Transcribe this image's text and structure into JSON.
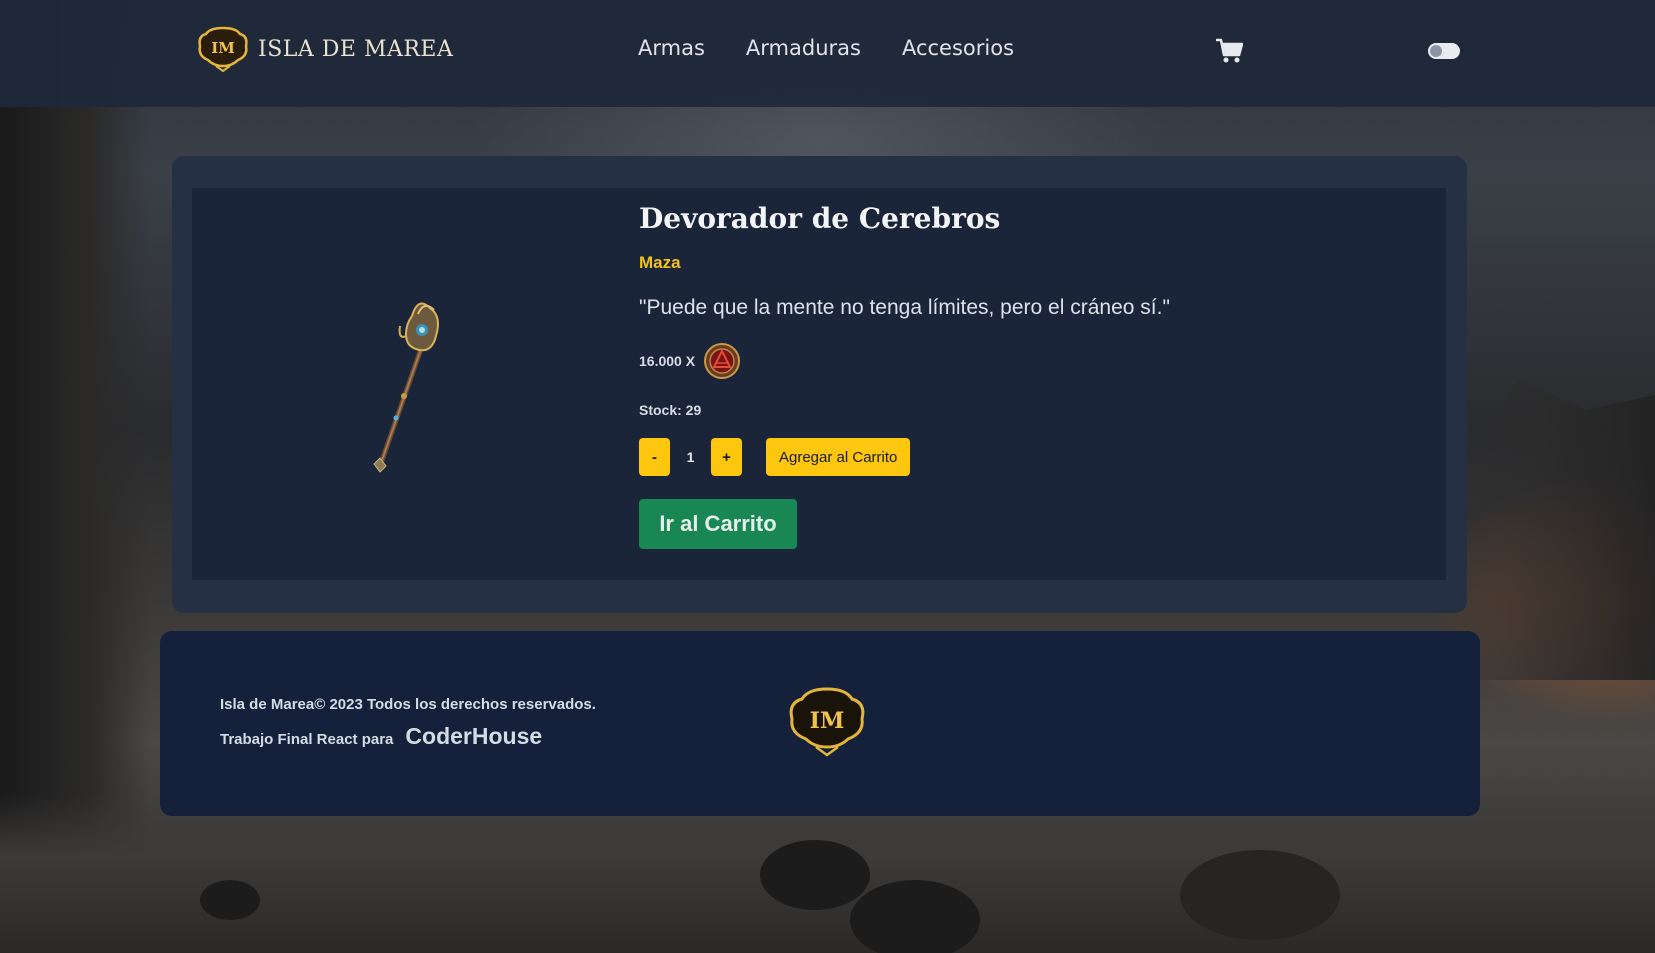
{
  "brand": {
    "name": "ISLA DE MAREA",
    "logo_text": "IM"
  },
  "nav": {
    "links": [
      {
        "label": "Armas"
      },
      {
        "label": "Armaduras"
      },
      {
        "label": "Accesorios"
      }
    ],
    "cart_icon": "shopping-cart-icon",
    "theme_toggle": "off"
  },
  "product": {
    "title": "Devorador de Cerebros",
    "category": "Maza",
    "description": "\"Puede que la mente no tenga límites, pero el cráneo sí.\"",
    "price_text": "16.000 X",
    "currency_icon": "gold-coin-icon",
    "stock_text": "Stock: 29",
    "quantity": "1",
    "decrement_label": "-",
    "increment_label": "+",
    "add_to_cart_label": "Agregar al Carrito",
    "go_to_cart_label": "Ir al Carrito"
  },
  "footer": {
    "copyright": "Isla de Marea© 2023 Todos los derechos reservados.",
    "made_for": "Trabajo Final React para",
    "link_label": "CoderHouse",
    "logo_text": "IM"
  },
  "colors": {
    "accent_yellow": "#fdc60f",
    "category_yellow": "#f4c21a",
    "success_green": "#198754",
    "navbar_bg": "#1e283a",
    "card_bg": "#1b2539",
    "footer_bg": "#15213a"
  }
}
